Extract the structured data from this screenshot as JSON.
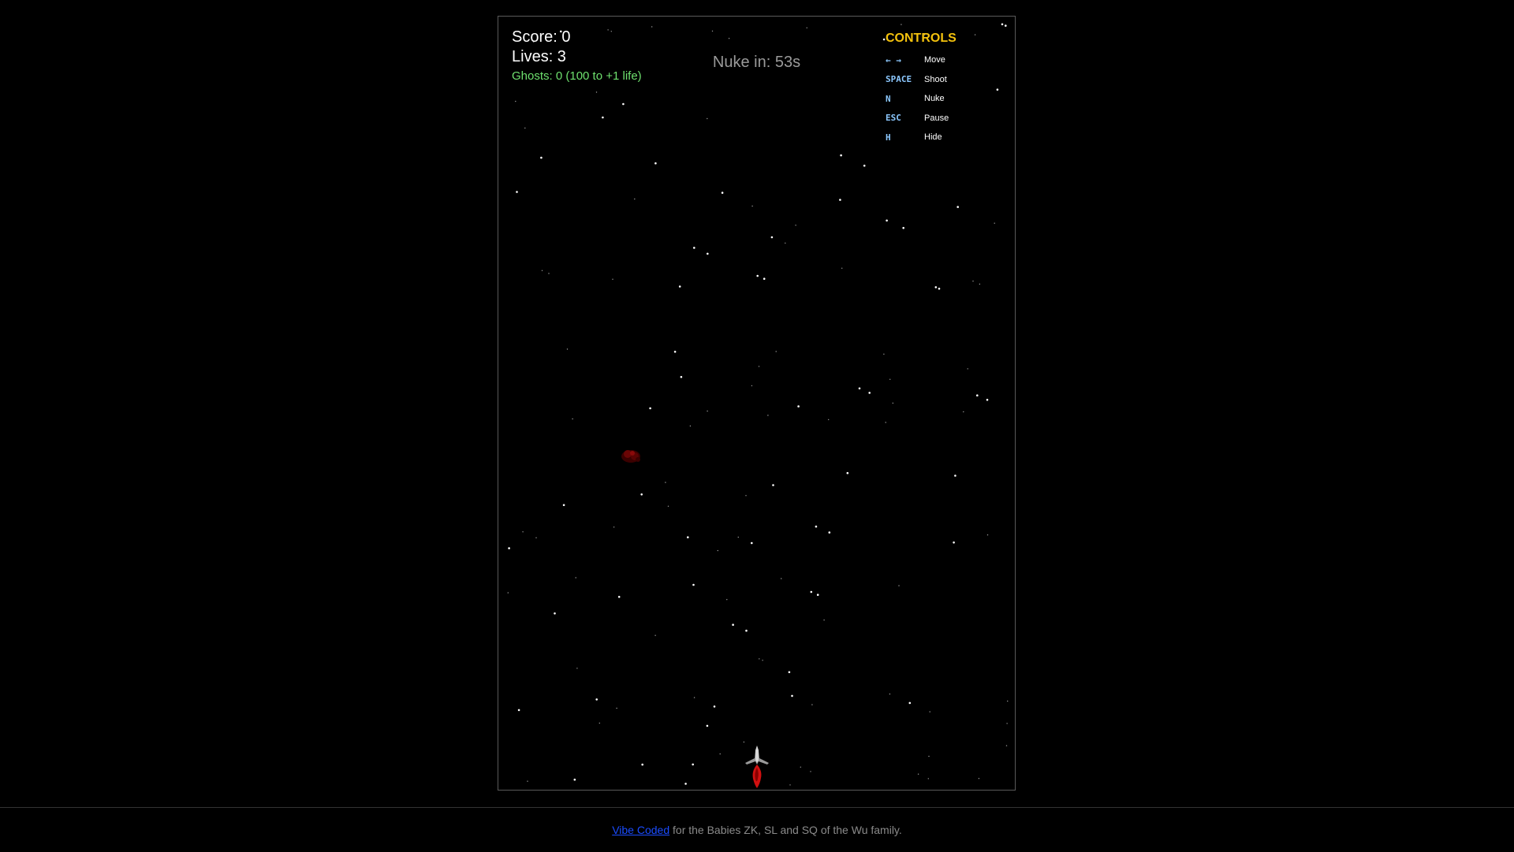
{
  "hud": {
    "score": "Score: 0",
    "lives": "Lives: 3",
    "ghosts": "Ghosts: 0 (100 to +1 life)",
    "nuke_timer": "Nuke in: 53s"
  },
  "controls": {
    "title": "CONTROLS",
    "items": [
      {
        "key": "← →",
        "action": "Move"
      },
      {
        "key": "SPACE",
        "action": "Shoot"
      },
      {
        "key": "N",
        "action": "Nuke"
      },
      {
        "key": "ESC",
        "action": "Pause"
      },
      {
        "key": "H",
        "action": "Hide"
      }
    ]
  },
  "footer": {
    "link_text": "Vibe Coded",
    "text": " for the Babies ZK, SL and SQ of the Wu family."
  },
  "colors": {
    "background": "#000000",
    "controls_title": "#f4c20d",
    "control_key": "#8cc8ff",
    "ghost_counter": "#6ee06e",
    "nuke_timer": "#9a9a9a",
    "link": "#1a4cff",
    "thruster": "#d01010"
  }
}
